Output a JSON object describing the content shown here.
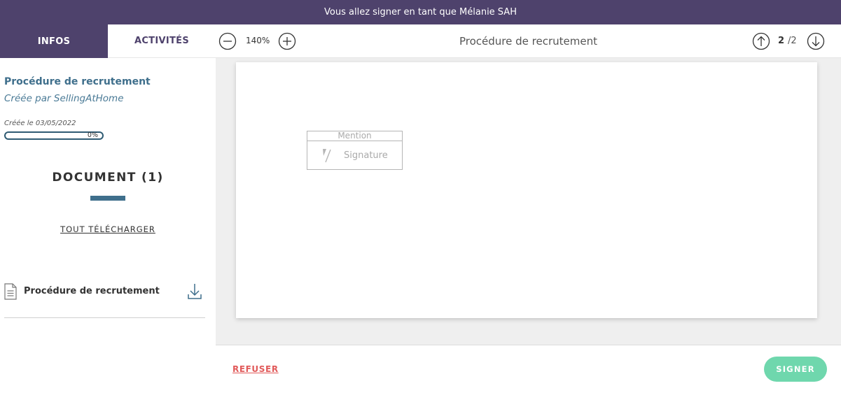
{
  "banner": {
    "text": "Vous allez signer en tant que Mélanie SAH"
  },
  "sidebar": {
    "tabs": [
      {
        "label": "INFOS",
        "active": true
      },
      {
        "label": "ACTIVITÉS",
        "active": false
      }
    ],
    "info": {
      "title": "Procédure de recrutement",
      "author": "Créée par SellingAtHome",
      "created": "Créée le 03/05/2022",
      "progress_label": "0%",
      "progress_value": 0
    },
    "documents": {
      "heading": "DOCUMENT (1)",
      "download_all": "TOUT TÉLÉCHARGER",
      "items": [
        {
          "name": "Procédure de recrutement",
          "icon": "document-icon",
          "action_icon": "download-icon"
        }
      ]
    }
  },
  "toolbar": {
    "zoom_out_icon": "minus-circle-icon",
    "zoom": "140%",
    "zoom_in_icon": "plus-circle-icon",
    "title": "Procédure de recrutement",
    "page_up_icon": "arrow-up-circle-icon",
    "page_current": "2",
    "page_total": "/2",
    "page_down_icon": "arrow-down-circle-icon"
  },
  "document": {
    "signature_field": {
      "mention": "Mention",
      "label": "Signature",
      "icon": "signature-pen-icon"
    }
  },
  "footer": {
    "refuse": "REFUSER",
    "sign": "SIGNER"
  },
  "colors": {
    "header": "#4e426c",
    "accent": "#3f6f8c",
    "refuse": "#e15a5a",
    "sign": "#6fd7ad",
    "viewer_bg": "#efefef"
  }
}
